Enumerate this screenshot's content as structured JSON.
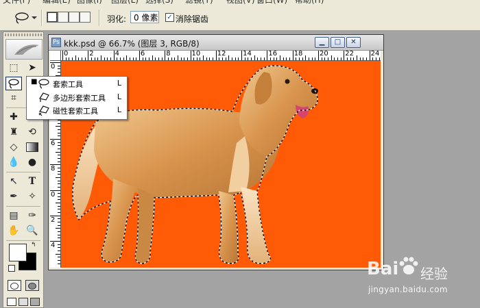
{
  "menu": {
    "items": [
      "文件(F)",
      "编辑(E)",
      "图像(I)",
      "图层(L)",
      "选择(S)",
      "滤镜(T)",
      "视图(V)",
      "窗口(W)",
      "帮助(H)"
    ]
  },
  "options_bar": {
    "feather_label": "羽化:",
    "feather_value": "0 像素",
    "antialias_label": "消除锯齿",
    "antialias_checked": true
  },
  "flyout": {
    "items": [
      {
        "label": "套索工具",
        "shortcut": "L",
        "selected": true,
        "icon": "lasso-icon"
      },
      {
        "label": "多边形套索工具",
        "shortcut": "L",
        "selected": false,
        "icon": "polygonal-lasso-icon"
      },
      {
        "label": "磁性套索工具",
        "shortcut": "L",
        "selected": false,
        "icon": "magnetic-lasso-icon"
      }
    ]
  },
  "document": {
    "title": "kkk.psd @ 66.7% (图层 3, RGB/8)",
    "ruler_top": [
      "0",
      "2",
      "4",
      "6",
      "8",
      "10",
      "12",
      "14",
      "16",
      "18",
      "20",
      "22",
      "24"
    ],
    "ruler_left": [
      "0",
      "2",
      "4",
      "6",
      "8",
      "0",
      "2",
      "4"
    ],
    "canvas_color": "#ff5a06"
  },
  "colors": {
    "foreground": "#ffffff",
    "background": "#000000"
  },
  "watermark": {
    "brand": "Bai",
    "brand_cn": "经验",
    "url": "jingyan.baidu.com"
  }
}
